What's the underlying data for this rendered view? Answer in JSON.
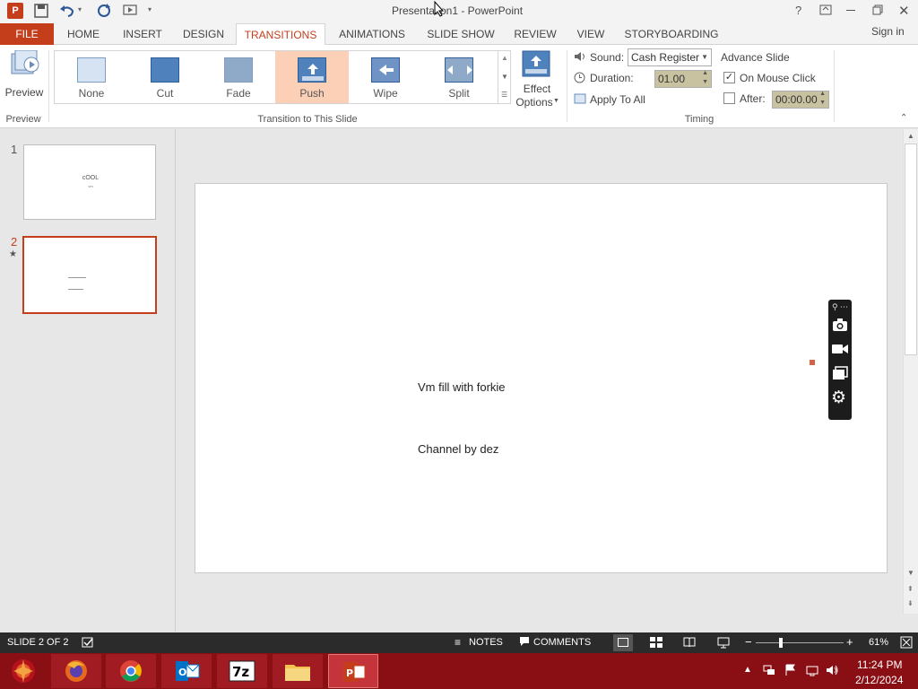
{
  "window": {
    "title": "Presentation1 - PowerPoint",
    "sign_in": "Sign in"
  },
  "tabs": [
    {
      "label": "FILE"
    },
    {
      "label": "HOME"
    },
    {
      "label": "INSERT"
    },
    {
      "label": "DESIGN"
    },
    {
      "label": "TRANSITIONS"
    },
    {
      "label": "ANIMATIONS"
    },
    {
      "label": "SLIDE SHOW"
    },
    {
      "label": "REVIEW"
    },
    {
      "label": "VIEW"
    },
    {
      "label": "STORYBOARDING"
    }
  ],
  "ribbon": {
    "preview_label": "Preview",
    "preview_group": "Preview",
    "transitions": [
      {
        "label": "None"
      },
      {
        "label": "Cut"
      },
      {
        "label": "Fade"
      },
      {
        "label": "Push"
      },
      {
        "label": "Wipe"
      },
      {
        "label": "Split"
      }
    ],
    "transitions_group": "Transition to This Slide",
    "effect_options_line1": "Effect",
    "effect_options_line2": "Options",
    "sound_label": "Sound:",
    "sound_value": "Cash Register",
    "duration_label": "Duration:",
    "duration_value": "01.00",
    "apply_all_label": "Apply To All",
    "advance_slide_label": "Advance Slide",
    "on_mouse_click_label": "On Mouse Click",
    "after_label": "After:",
    "after_value": "00:00.00",
    "timing_group": "Timing"
  },
  "slides": {
    "thumb1": {
      "number": "1",
      "title": "cOOL",
      "sub": "vm"
    },
    "thumb2": {
      "number": "2",
      "star": "★"
    }
  },
  "slide": {
    "line1": "Vm fill with forkie",
    "line2": "Channel by dez"
  },
  "status": {
    "slide_counter": "SLIDE 2 OF 2",
    "notes": "NOTES",
    "comments": "COMMENTS",
    "zoom": "61%"
  },
  "taskbar": {
    "time": "11:24 PM",
    "date": "2/12/2024"
  },
  "colors": {
    "accent": "#c43e1c",
    "status_bg": "#2b2b2b",
    "taskbar_bg": "#8a0f14"
  }
}
